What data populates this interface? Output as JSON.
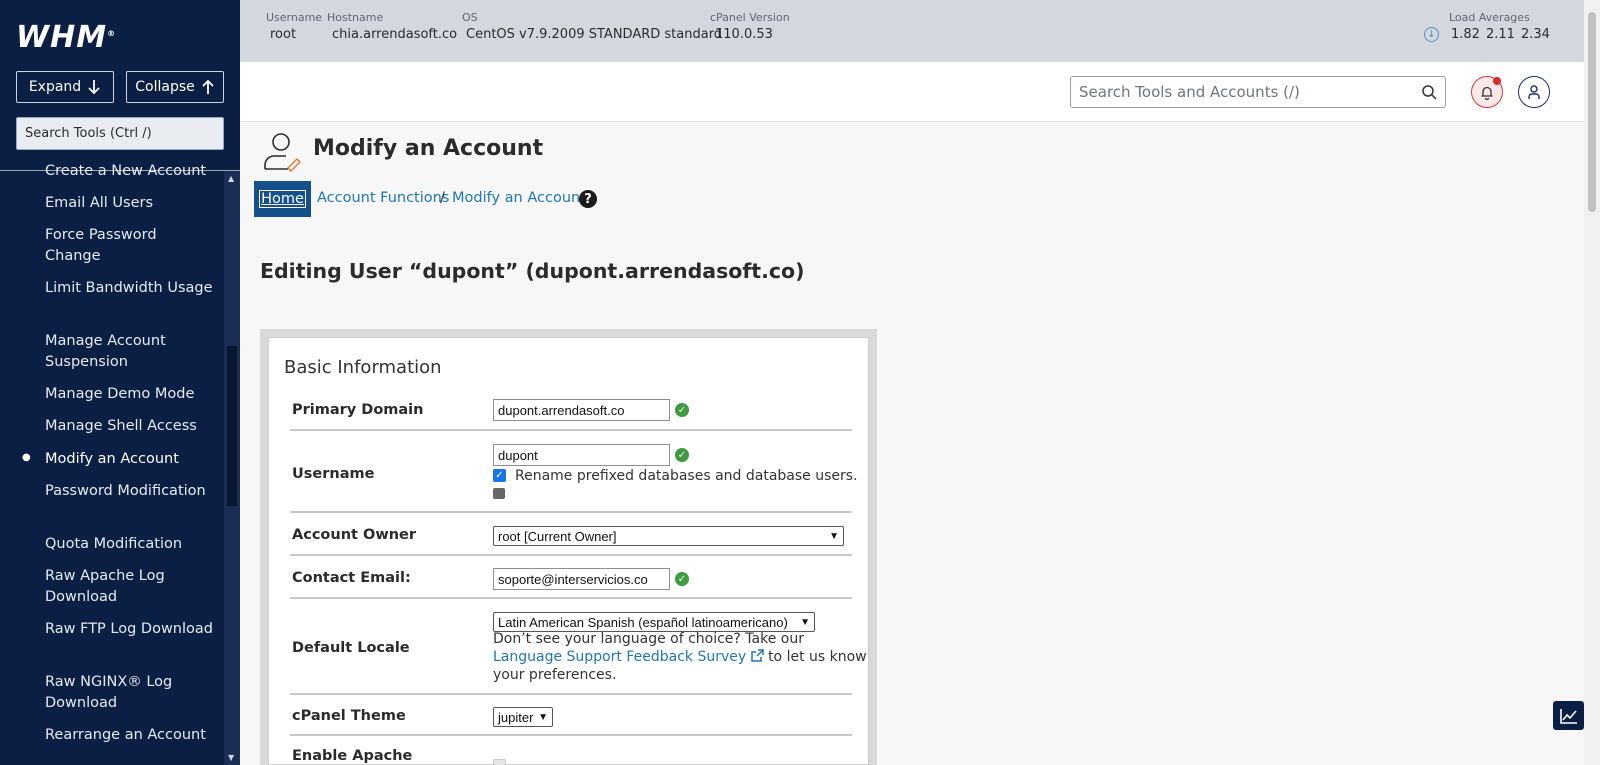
{
  "brand": {
    "logo": "WHM",
    "trademark": "®"
  },
  "sidebar": {
    "expand_label": "Expand",
    "collapse_label": "Collapse",
    "search_placeholder": "Search Tools (Ctrl /)",
    "items": [
      {
        "label": "Create a New Account"
      },
      {
        "label": "Email All Users"
      },
      {
        "label": "Force Password Change"
      },
      {
        "label": "Limit Bandwidth Usage"
      },
      {
        "label": "Manage Account Suspension"
      },
      {
        "label": "Manage Demo Mode"
      },
      {
        "label": "Manage Shell Access"
      },
      {
        "label": "Modify an Account",
        "active": true
      },
      {
        "label": "Password Modification"
      },
      {
        "label": "Quota Modification"
      },
      {
        "label": "Raw Apache Log Download"
      },
      {
        "label": "Raw FTP Log Download"
      },
      {
        "label": "Raw NGINX® Log Download"
      },
      {
        "label": "Rearrange an Account"
      }
    ]
  },
  "status": {
    "username_label": "Username",
    "username": "root",
    "hostname_label": "Hostname",
    "hostname": "chia.arrendasoft.co",
    "os_label": "OS",
    "os": "CentOS v7.9.2009 STANDARD standard",
    "cpanel_label": "cPanel Version",
    "cpanel_version": "110.0.53",
    "load_label": "Load Averages",
    "load_1": "1.82",
    "load_5": "2.11",
    "load_15": "2.34"
  },
  "header": {
    "search_placeholder": "Search Tools and Accounts (/)"
  },
  "page": {
    "title": "Modify an Account",
    "breadcrumb": {
      "home": "Home",
      "section": "Account Functions",
      "separator": "/",
      "current": "Modify an Account"
    },
    "help": "?",
    "editing_heading": "Editing User “dupont” (dupont.arrendasoft.co)"
  },
  "form": {
    "section_title": "Basic Information",
    "primary_domain_label": "Primary Domain",
    "primary_domain_value": "dupont.arrendasoft.co",
    "username_label": "Username",
    "username_value": "dupont",
    "rename_db_label": "Rename prefixed databases and database users.",
    "account_owner_label": "Account Owner",
    "account_owner_value": "root [Current Owner]",
    "contact_email_label": "Contact Email:",
    "contact_email_value": "soporte@interservicios.co",
    "default_locale_label": "Default Locale",
    "default_locale_value": "Latin American Spanish (español latinoamericano)",
    "locale_note_1": "Don’t see your language of choice? Take our",
    "locale_link": "Language Support Feedback Survey",
    "locale_note_2": "to let us know",
    "locale_note_3": "your preferences.",
    "theme_label": "cPanel Theme",
    "theme_value": "jupiter",
    "enable_apache_label": "Enable Apache"
  },
  "colors": {
    "sidebar_bg": "#0b1e43",
    "topbar_bg": "#d3d8df",
    "link": "#1f76b8",
    "ok_green": "#3f9b3f",
    "alert_red": "#d92b2b"
  }
}
